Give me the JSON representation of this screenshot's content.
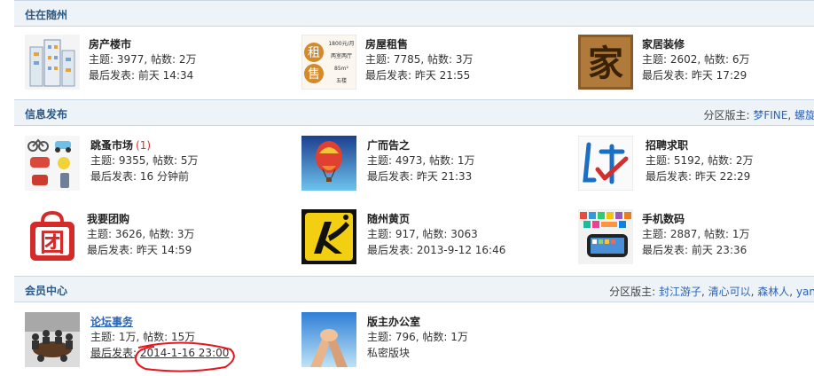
{
  "sections": [
    {
      "title": "住在随州",
      "moderators": null
    },
    {
      "title": "信息发布",
      "moderators": {
        "label": "分区版主:",
        "names": [
          "梦FINE",
          "螺旋"
        ]
      }
    },
    {
      "title": "会员中心",
      "moderators": {
        "label": "分区版主:",
        "names": [
          "封江游子",
          "清心可以",
          "森林人",
          "yan"
        ]
      }
    }
  ],
  "forums": {
    "fangchan": {
      "name": "房产楼市",
      "stats": "主题: 3977, 帖数: 2万",
      "last": "最后发表: 前天 14:34"
    },
    "zushou": {
      "name": "房屋租售",
      "stats": "主题: 7785, 帖数: 3万",
      "last": "最后发表: 昨天 21:55",
      "icon_text": [
        "1800元/月",
        "两室两厅",
        "85m²",
        "五楼"
      ],
      "icon_chars": [
        "租",
        "售"
      ]
    },
    "jiaju": {
      "name": "家居装修",
      "stats": "主题: 2602, 帖数: 6万",
      "last": "最后发表: 昨天 17:29",
      "icon_char": "家"
    },
    "tiaozao": {
      "name": "跳蚤市场",
      "new_count": "(1)",
      "stats": "主题: 9355, 帖数: 5万",
      "last": "最后发表: 16 分钟前"
    },
    "guanggao": {
      "name": "广而告之",
      "stats": "主题: 4973, 帖数: 1万",
      "last": "最后发表: 昨天 21:33"
    },
    "zhaopin": {
      "name": "招聘求职",
      "stats": "主题: 5192, 帖数: 2万",
      "last": "最后发表: 昨天 22:29"
    },
    "tuangou": {
      "name": "我要团购",
      "stats": "主题: 3626, 帖数: 3万",
      "last": "最后发表: 昨天 14:59",
      "icon_char": "团"
    },
    "huangye": {
      "name": "随州黄页",
      "stats": "主题: 917, 帖数: 3063",
      "last": "最后发表: 2013-9-12 16:46"
    },
    "shouji": {
      "name": "手机数码",
      "stats": "主题: 2887, 帖数: 1万",
      "last": "最后发表: 前天 23:36"
    },
    "luntan": {
      "name": "论坛事务",
      "stats": "主题: 1万, 帖数: 15万",
      "last_label": "最后发表:",
      "last_value": "2014-1-16 23:00"
    },
    "banzhu": {
      "name": "版主办公室",
      "stats": "主题: 796, 帖数: 1万",
      "note": "私密版块"
    }
  },
  "colors": {
    "header_bg": "#eef3f8",
    "title": "#2f5a86",
    "link": "#2d64b3",
    "new": "#d0332b",
    "annotation": "#e8141c"
  }
}
